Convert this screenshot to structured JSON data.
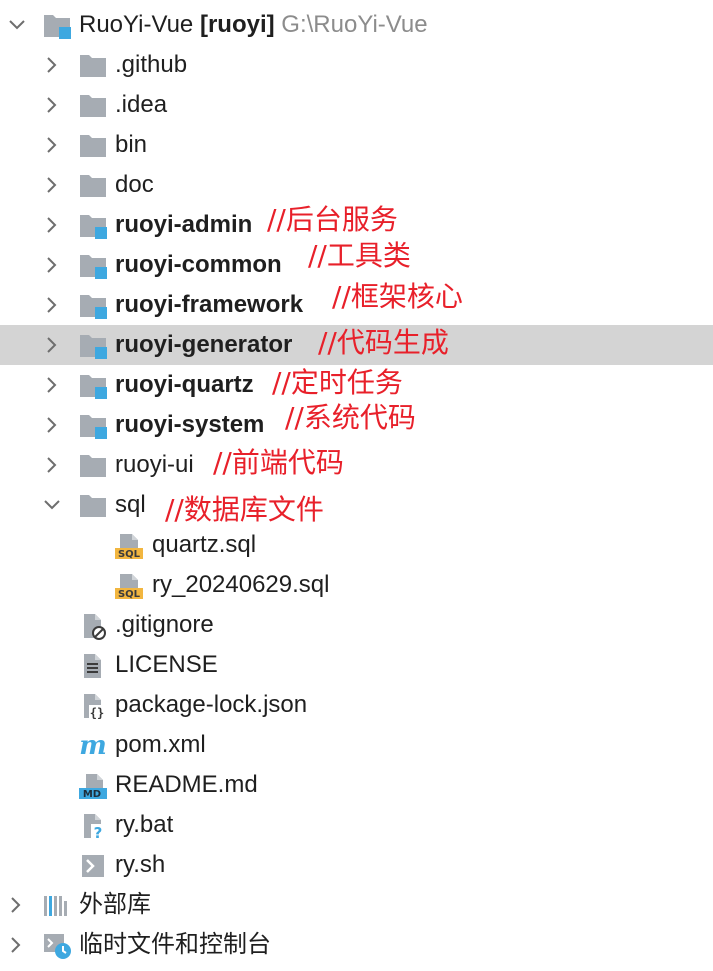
{
  "project": {
    "name": "RuoYi-Vue",
    "module": "[ruoyi]",
    "path": "G:\\RuoYi-Vue"
  },
  "folders": [
    {
      "label": ".github"
    },
    {
      "label": ".idea"
    },
    {
      "label": "bin"
    },
    {
      "label": "doc"
    },
    {
      "label": "ruoyi-admin",
      "annotation": "//后台服务"
    },
    {
      "label": "ruoyi-common",
      "annotation": "//工具类"
    },
    {
      "label": "ruoyi-framework",
      "annotation": "//框架核心"
    },
    {
      "label": "ruoyi-generator",
      "annotation": "//代码生成"
    },
    {
      "label": "ruoyi-quartz",
      "annotation": "//定时任务"
    },
    {
      "label": "ruoyi-system",
      "annotation": "//系统代码"
    },
    {
      "label": "ruoyi-ui",
      "annotation": "//前端代码"
    },
    {
      "label": "sql",
      "annotation": "//数据库文件"
    }
  ],
  "sql_files": [
    {
      "label": "quartz.sql"
    },
    {
      "label": "ry_20240629.sql"
    }
  ],
  "files": [
    {
      "label": ".gitignore"
    },
    {
      "label": "LICENSE"
    },
    {
      "label": "package-lock.json"
    },
    {
      "label": "pom.xml"
    },
    {
      "label": "README.md"
    },
    {
      "label": "ry.bat"
    },
    {
      "label": "ry.sh"
    }
  ],
  "bottom": [
    {
      "label": "外部库"
    },
    {
      "label": "临时文件和控制台"
    }
  ],
  "icons": {
    "sql_badge": "SQL",
    "md_badge": "MD",
    "maven": "m"
  },
  "colors": {
    "selected_row": "#d4d4d4",
    "annotation": "#e8202a",
    "folder_gray": "#a6acb3",
    "module_blue": "#3ea8e0"
  }
}
